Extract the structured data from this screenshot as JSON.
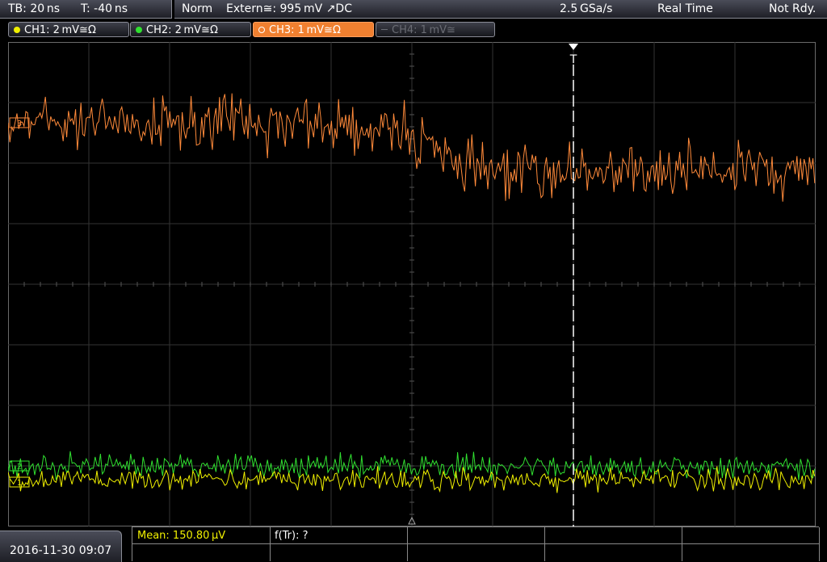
{
  "status": {
    "timebase": "TB: 20 ns",
    "trigger_time": "T: -40 ns",
    "mode": "Norm",
    "trigger_source": "Extern≅: 995 mV ↗DC",
    "sample_rate": "2.5 GSa/s",
    "acquisition": "Real Time",
    "state": "Not Rdy."
  },
  "channels": [
    {
      "label": "CH1: 2 mV≅Ω",
      "color": "#f0f000"
    },
    {
      "label": "CH2: 2 mV≅Ω",
      "color": "#30e030"
    },
    {
      "label": "CH3: 1 mV≅Ω",
      "color": "#ff8a3a"
    },
    {
      "label": "CH4: 1 mV≅",
      "color": "#6a6c74"
    }
  ],
  "trigger_marker": "T",
  "measurements": {
    "mean": "Mean: 150.80 µV",
    "freq": "f(Tr): ?"
  },
  "datetime": "2016-11-30 09:07",
  "colors": {
    "ch1": "#f0f000",
    "ch2": "#30e030",
    "ch3": "#ff8a3a",
    "grid": "#3a3a3a",
    "cursor": "#ffffff"
  }
}
